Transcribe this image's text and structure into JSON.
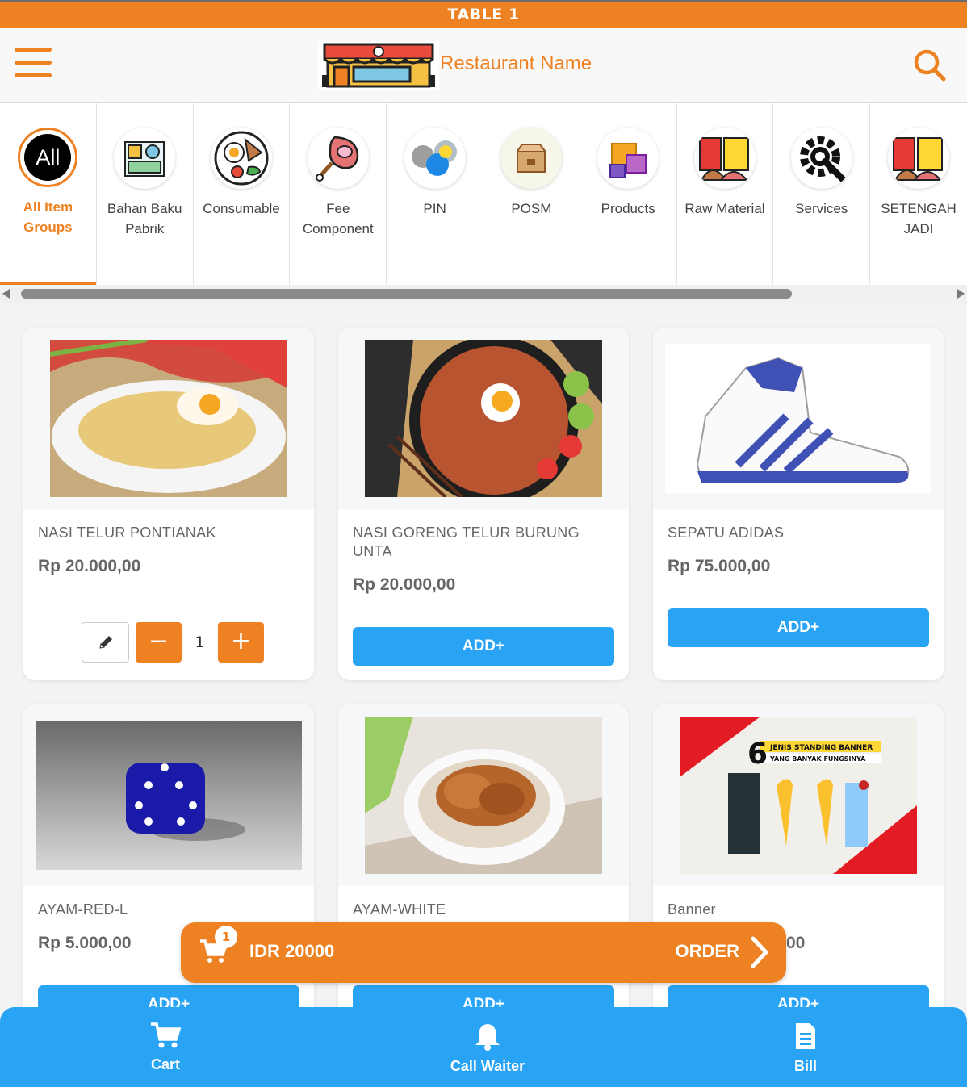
{
  "table_label": "TABLE 1",
  "restaurant_name": "Restaurant Name",
  "categories": [
    {
      "label": "All Item Groups",
      "icon": "all-icon",
      "active": true
    },
    {
      "label": "Bahan Baku Pabrik",
      "icon": "factory-materials-icon"
    },
    {
      "label": "Consumable",
      "icon": "meal-plate-icon"
    },
    {
      "label": "Fee Component",
      "icon": "ham-icon"
    },
    {
      "label": "PIN",
      "icon": "pin-badges-icon"
    },
    {
      "label": "POSM",
      "icon": "box-icon"
    },
    {
      "label": "Products",
      "icon": "products-boxes-icon"
    },
    {
      "label": "Raw Material",
      "icon": "raw-material-icon"
    },
    {
      "label": "Services",
      "icon": "gear-wrench-icon"
    },
    {
      "label": "SETENGAH JADI",
      "icon": "raw-material-icon"
    }
  ],
  "all_icon_text": "All",
  "products": [
    {
      "name": "NASI TELUR PONTIANAK",
      "price": "Rp 20.000,00",
      "qty": "1",
      "in_cart": true
    },
    {
      "name": "NASI GORENG TELUR BURUNG UNTA",
      "price": "Rp 20.000,00",
      "button": "ADD+"
    },
    {
      "name": "SEPATU ADIDAS",
      "price": "Rp 75.000,00",
      "button": "ADD+"
    },
    {
      "name": "AYAM-RED-L",
      "price": "Rp 5.000,00",
      "button": "ADD+"
    },
    {
      "name": "AYAM-WHITE",
      "price": "",
      "button": "ADD+"
    },
    {
      "name": "Banner",
      "price": "",
      "price_tail": "00",
      "button": "ADD+"
    }
  ],
  "banner_image": {
    "big_number": "6",
    "line1": "JENIS STANDING BANNER",
    "line2": "YANG BANYAK FUNGSINYA"
  },
  "order_bar": {
    "badge": "1",
    "total": "IDR 20000",
    "order_label": "ORDER"
  },
  "bottom_nav": {
    "cart": "Cart",
    "call_waiter": "Call Waiter",
    "bill": "Bill"
  },
  "colors": {
    "accent": "#ee8222",
    "blue": "#29a3f3"
  }
}
